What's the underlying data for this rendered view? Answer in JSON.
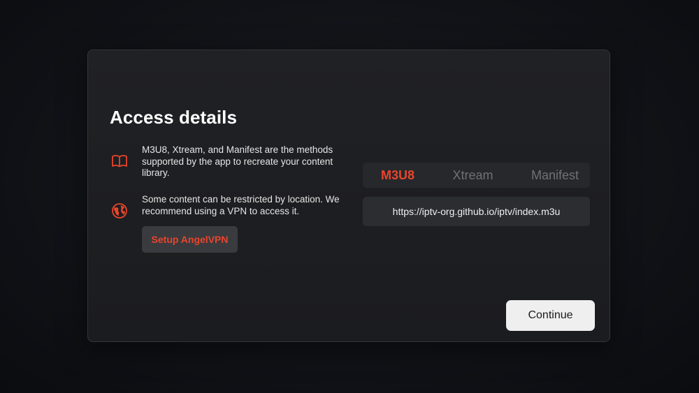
{
  "dialog": {
    "title": "Access details",
    "info": [
      {
        "icon": "book-icon",
        "text": "M3U8, Xtream, and Manifest are the methods supported by the app to recreate your content library."
      },
      {
        "icon": "globe-icon",
        "text": "Some content can be restricted by location. We recommend using a VPN to access it."
      }
    ],
    "vpn_button_label": "Setup AngelVPN",
    "tabs": [
      {
        "label": "M3U8",
        "active": true
      },
      {
        "label": "Xtream",
        "active": false
      },
      {
        "label": "Manifest",
        "active": false
      }
    ],
    "url_value": "https://iptv-org.github.io/iptv/index.m3u",
    "continue_label": "Continue"
  },
  "colors": {
    "accent": "#e8452c",
    "panel_background": "#1e1f22",
    "tab_inactive": "#6f7177",
    "button_light": "#efefef"
  }
}
